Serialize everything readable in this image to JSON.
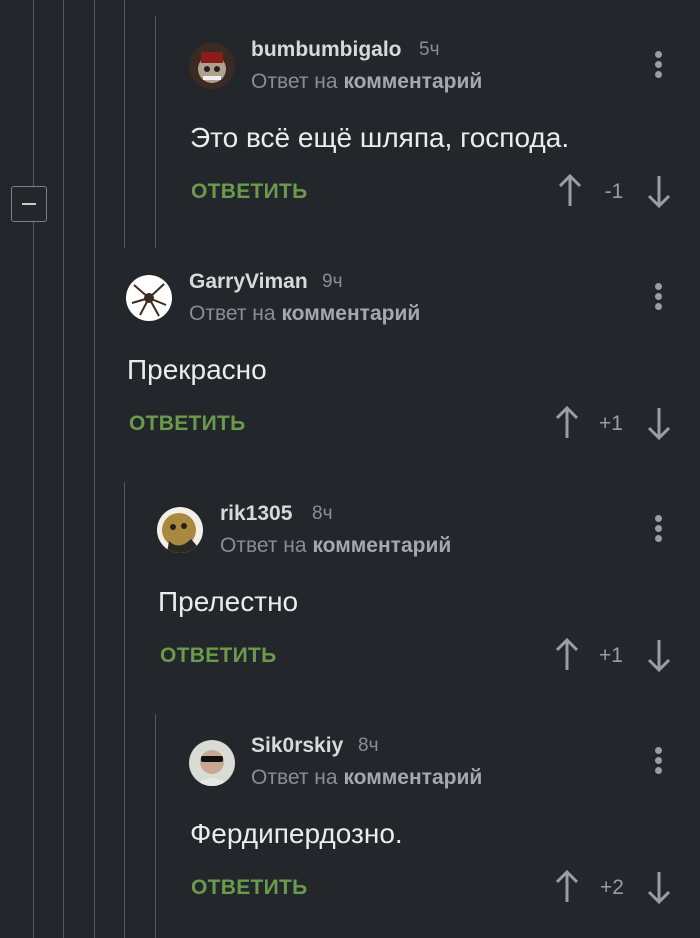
{
  "reply_prefix": "Ответ на",
  "reply_link": "комментарий",
  "reply_button": "ОТВЕТИТЬ",
  "comments": [
    {
      "username": "bumbumbigalo",
      "time": "5ч",
      "text": "Это всё ещё шляпа, господа.",
      "rating": "-1"
    },
    {
      "username": "GarryViman",
      "time": "9ч",
      "text": "Прекрасно",
      "rating": "+1"
    },
    {
      "username": "rik1305",
      "time": "8ч",
      "text": "Прелестно",
      "rating": "+1"
    },
    {
      "username": "Sik0rskiy",
      "time": "8ч",
      "text": "Фердипердозно.",
      "rating": "+2"
    }
  ],
  "colors": {
    "background": "#23262b",
    "reply_green": "#6a9a4c",
    "thread_line": "#55595f"
  }
}
